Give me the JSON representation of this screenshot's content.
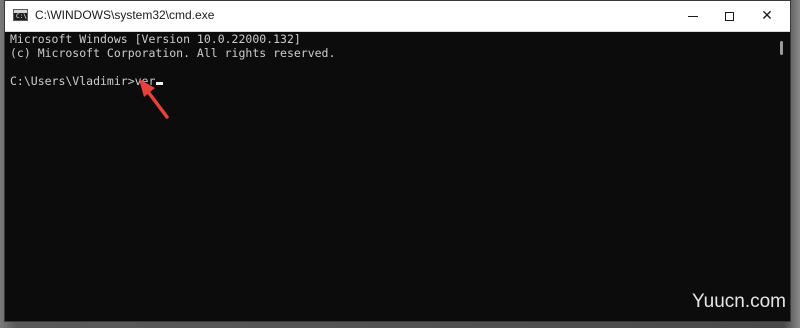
{
  "window": {
    "title": "C:\\WINDOWS\\system32\\cmd.exe",
    "icon": "cmd-prompt-icon",
    "icon_glyph": "C:\\"
  },
  "caption_buttons": {
    "minimize_icon": "minimize-icon",
    "maximize_icon": "maximize-icon",
    "close_glyph": "✕"
  },
  "console": {
    "lines": [
      "Microsoft Windows [Version 10.0.22000.132]",
      "(c) Microsoft Corporation. All rights reserved.",
      "",
      "C:\\Users\\Vladimir>ver"
    ],
    "text_color": "#cccccc",
    "background_color": "#0c0c0c"
  },
  "annotation": {
    "arrow_color": "#e8413c"
  },
  "watermark": {
    "text": "Yuucn.com"
  }
}
